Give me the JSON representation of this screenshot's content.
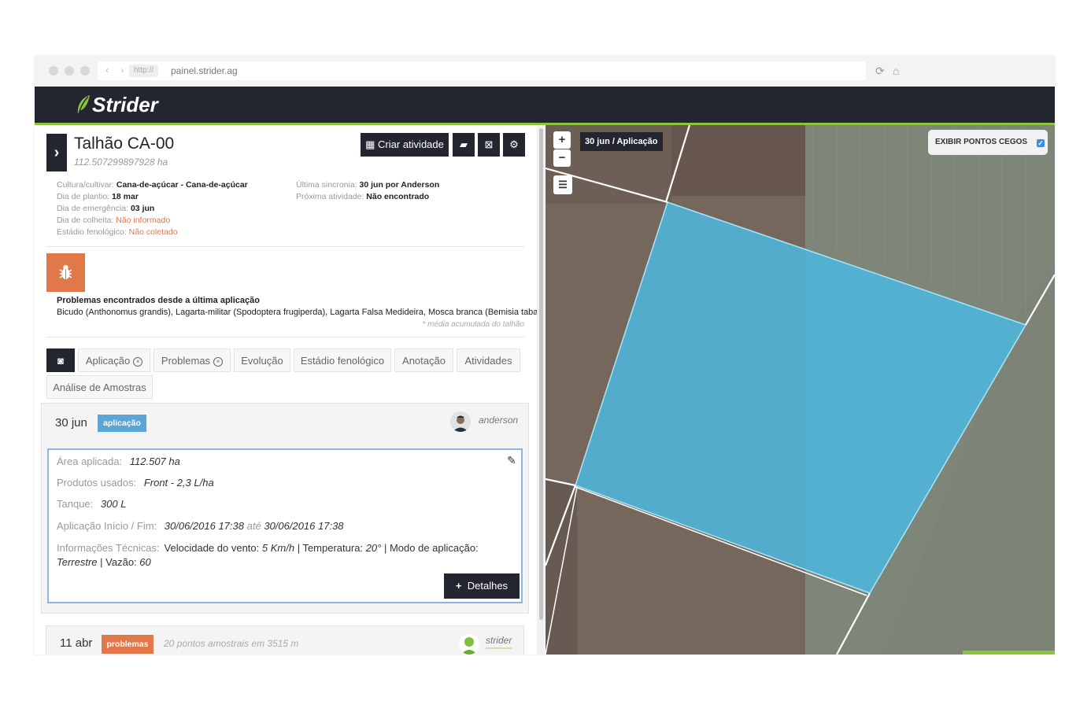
{
  "browser": {
    "http_label": "http://",
    "url": "painel.strider.ag"
  },
  "app": {
    "logo": "Strider"
  },
  "field": {
    "title": "Talhão CA-00",
    "area": "112.507299897928 ha",
    "create_activity": "Criar atividade"
  },
  "info_left": [
    {
      "label": "Cultura/cultivar: ",
      "value": "Cana-de-açúcar - Cana-de-açúcar",
      "warn": false
    },
    {
      "label": "Dia de plantio: ",
      "value": "18 mar",
      "warn": false
    },
    {
      "label": "Dia de emergência: ",
      "value": "03 jun",
      "warn": false
    },
    {
      "label": "Dia de colheita: ",
      "value": "Não informado",
      "warn": true
    },
    {
      "label": "Estádio fenológico: ",
      "value": "Não coletado",
      "warn": true
    }
  ],
  "info_right": [
    {
      "label": "Última sincronia: ",
      "value": "30 jun por Anderson"
    },
    {
      "label": "Próxima atividade: ",
      "value": "Não encontrado"
    }
  ],
  "problems": {
    "heading": "Problemas encontrados desde a última aplicação",
    "text": "Bicudo (Anthonomus grandis), Lagarta-militar (Spodoptera frugiperda), Lagarta Falsa Medideira, Mosca branca (Bemisia tabaci)",
    "note": "* média acumulada do talhão"
  },
  "tabs": [
    {
      "label": "Aplicação",
      "removable": true
    },
    {
      "label": "Problemas",
      "removable": true
    },
    {
      "label": "Evolução",
      "removable": false
    },
    {
      "label": "Estádio fenológico",
      "removable": false
    },
    {
      "label": "Anotação",
      "removable": false
    },
    {
      "label": "Atividades",
      "removable": false
    },
    {
      "label": "Análise de Amostras",
      "removable": false
    }
  ],
  "activity": {
    "date": "30 jun",
    "badge": "aplicação",
    "user": "anderson",
    "area_label": "Área aplicada:",
    "area_value": "112.507 ha",
    "products_label": "Produtos usados:",
    "products_value": "Front - 2,3 L/ha",
    "tank_label": "Tanque:",
    "tank_value": "300 L",
    "period_label": "Aplicação Início / Fim:",
    "period_start": "30/06/2016 17:38",
    "period_sep": "até",
    "period_end": "30/06/2016 17:38",
    "tech_label": "Informações Técnicas:",
    "tech_wind_label": "Velocidade do vento:",
    "tech_wind_value": "5 Km/h",
    "tech_temp_label": "| Temperatura:",
    "tech_temp_value": "20°",
    "tech_mode_label": "| Modo de aplicação:",
    "tech_mode_value": "Terrestre",
    "tech_flow_label": "| Vazão:",
    "tech_flow_value": "60",
    "details_button": "Detalhes"
  },
  "activity2": {
    "date": "11 abr",
    "badge": "problemas",
    "summary": "20 pontos amostrais em 3515 m",
    "user": "strider"
  },
  "map": {
    "zoom_in": "+",
    "zoom_out": "−",
    "layer_label": "30 jun / Aplicação",
    "blind_spots_label": "EXIBIR PONTOS CEGOS",
    "blind_spots_checked": true,
    "polygon_color": "#4fb6dc"
  },
  "colors": {
    "accent": "#8bc53f",
    "dark": "#23252f",
    "warning": "#e0784a",
    "info_badge": "#5aa6d6"
  }
}
